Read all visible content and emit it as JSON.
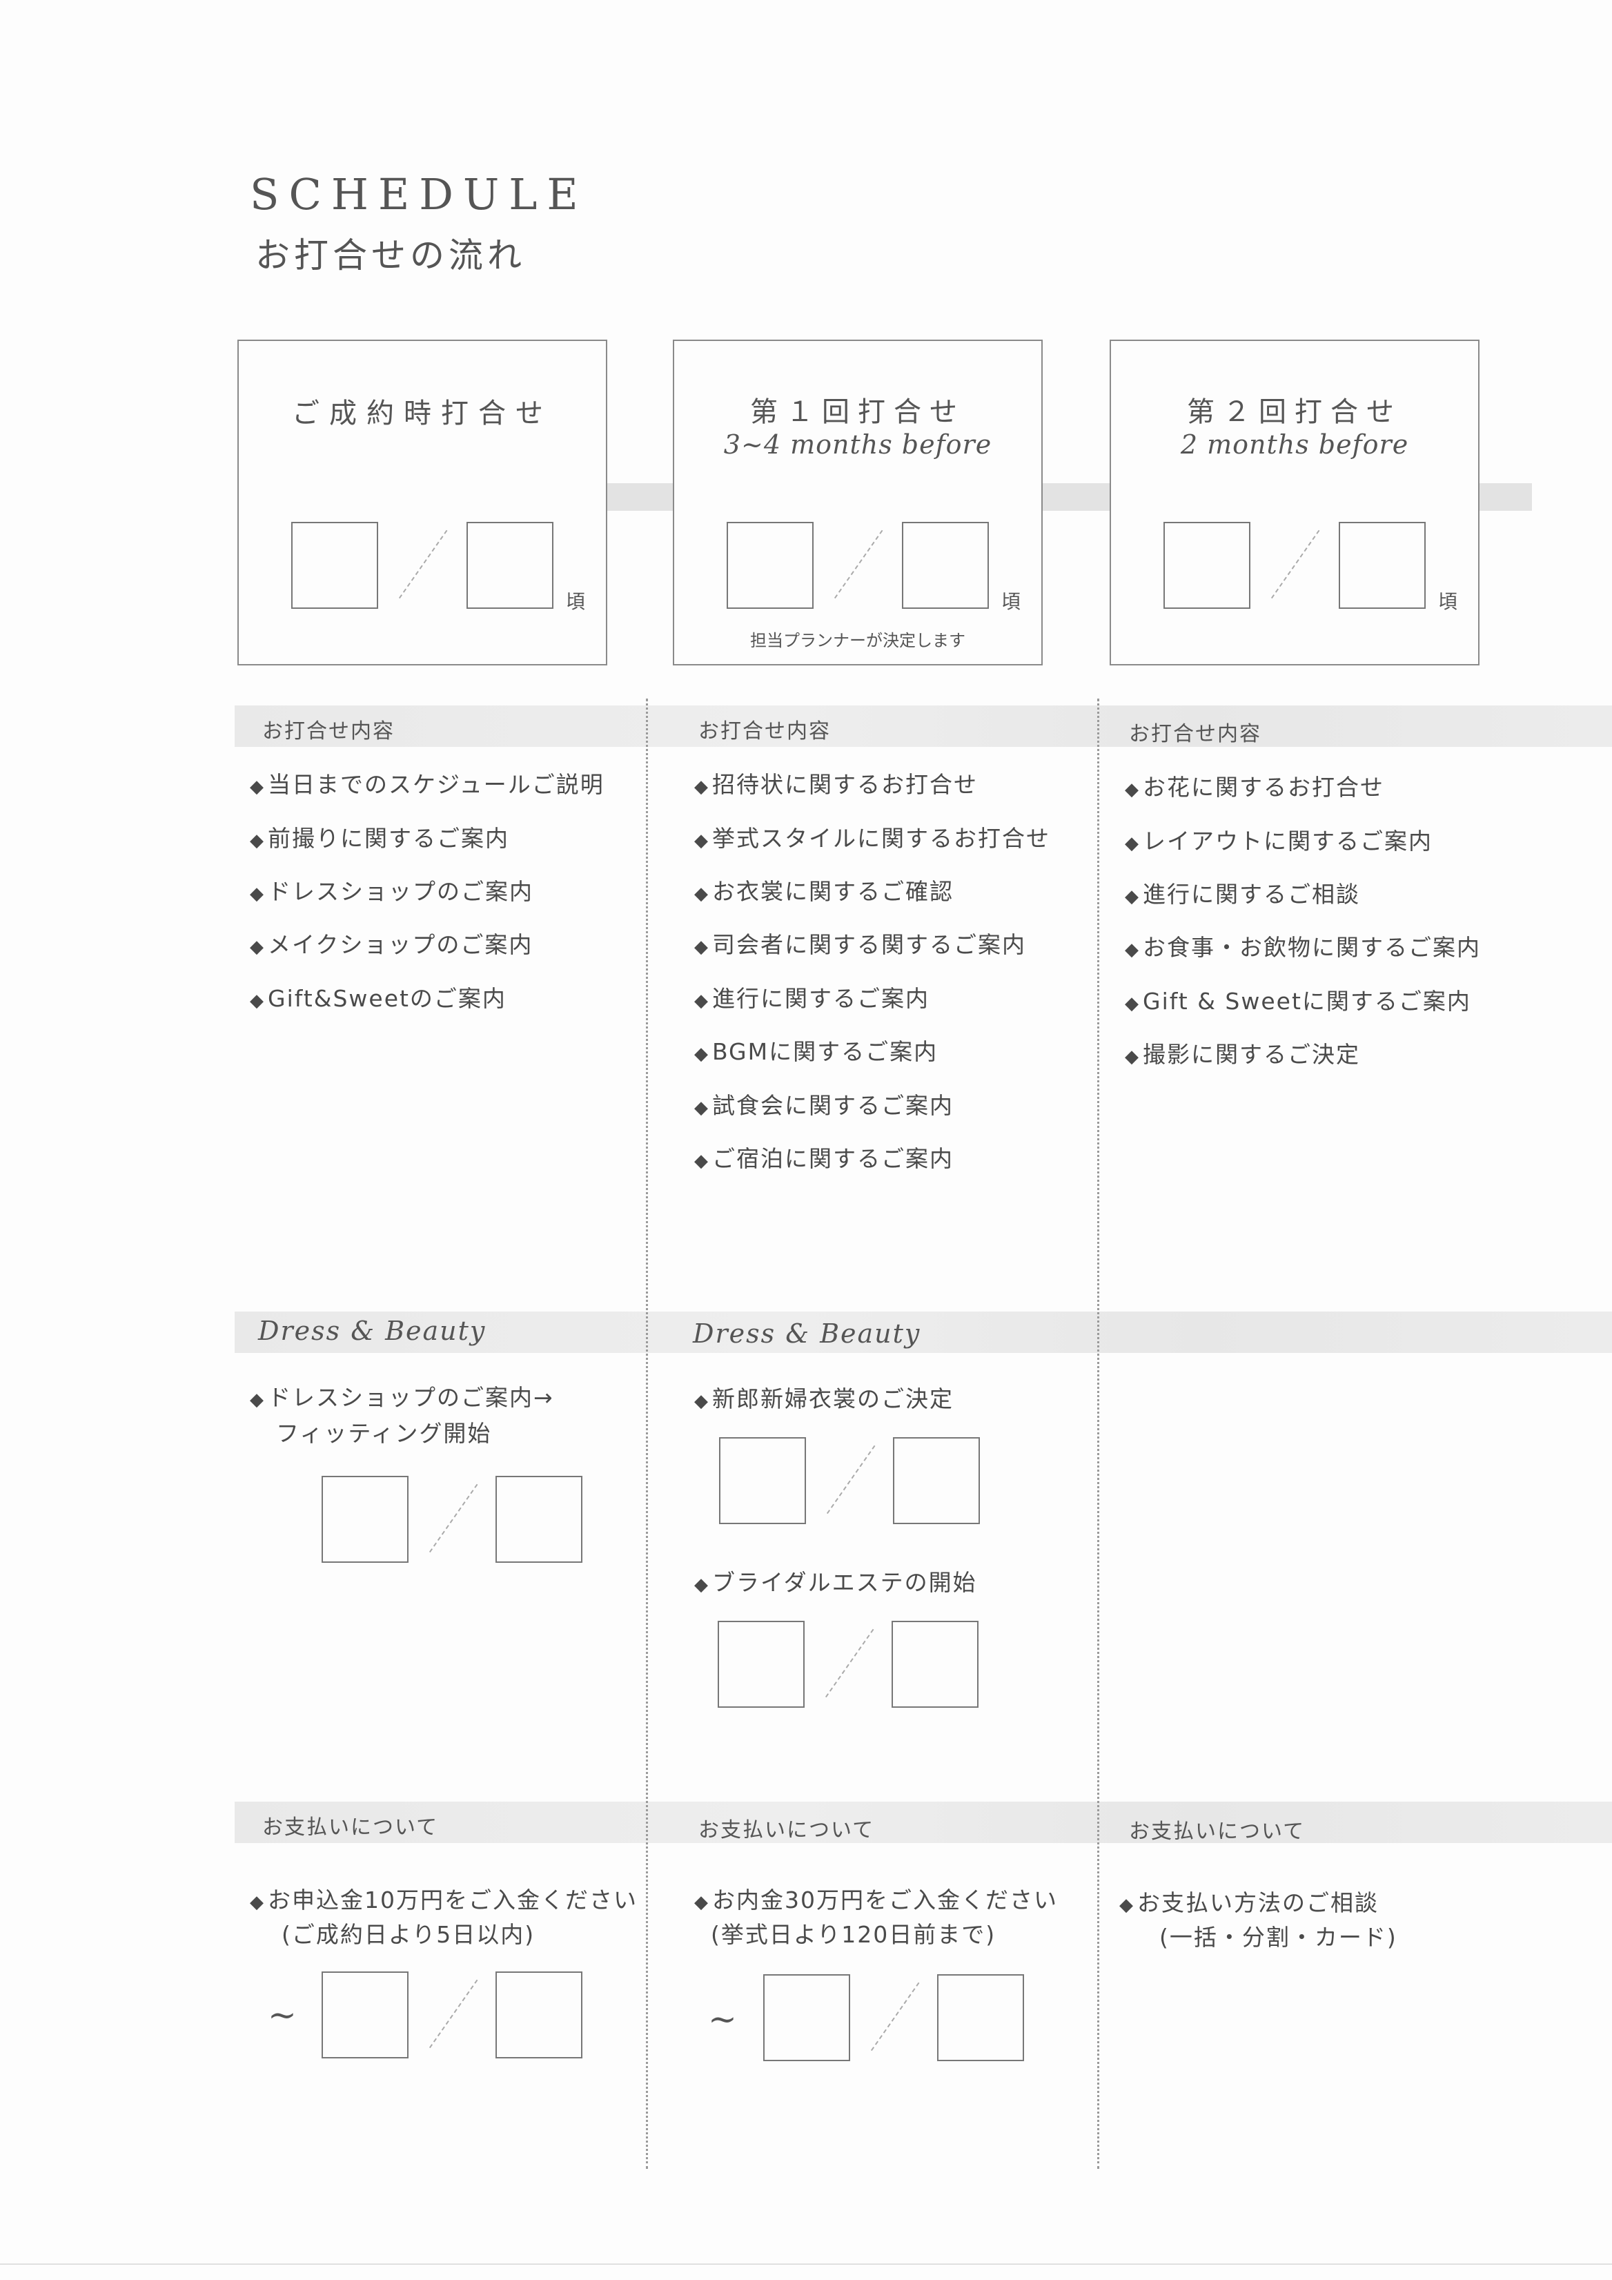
{
  "header": {
    "title_en": "SCHEDULE",
    "title_ja": "お打合せの流れ"
  },
  "boxes": [
    {
      "line1": "ご成約時打合せ",
      "line2": "",
      "goro": "頃",
      "note": ""
    },
    {
      "line1": "第１回打合せ",
      "line2": "3~4 months before",
      "goro": "頃",
      "note": "担当プランナーが決定します"
    },
    {
      "line1": "第２回打合せ",
      "line2": "2 months before",
      "goro": "頃",
      "note": ""
    }
  ],
  "section_meeting": {
    "heading": "お打合せ内容",
    "col1": [
      "当日までのスケジュールご説明",
      "前撮りに関するご案内",
      "ドレスショップのご案内",
      "メイクショップのご案内",
      "Gift&Sweetのご案内"
    ],
    "col2": [
      "招待状に関するお打合せ",
      "挙式スタイルに関するお打合せ",
      "お衣裳に関するご確認",
      "司会者に関する関するご案内",
      "進行に関するご案内",
      "BGMに関するご案内",
      "試食会に関するご案内",
      "ご宿泊に関するご案内"
    ],
    "col3": [
      "お花に関するお打合せ",
      "レイアウトに関するご案内",
      "進行に関するご相談",
      "お食事・お飲物に関するご案内",
      "Gift & Sweetに関するご案内",
      "撮影に関するご決定"
    ]
  },
  "section_dress": {
    "heading": "Dress & Beauty",
    "col1": [
      "ドレスショップのご案内→",
      "フィッティング開始"
    ],
    "col2": [
      "新郎新婦衣裳のご決定",
      "ブライダルエステの開始"
    ]
  },
  "section_payment": {
    "heading": "お支払いについて",
    "col1": [
      "お申込金10万円をご入金ください",
      "(ご成約日より5日以内)"
    ],
    "col2": [
      "お内金30万円をご入金ください",
      "(挙式日より120日前まで)"
    ],
    "col3": [
      "お支払い方法のご相談",
      "(一括・分割・カード)"
    ],
    "tilde": "~"
  },
  "bullet": "◆"
}
